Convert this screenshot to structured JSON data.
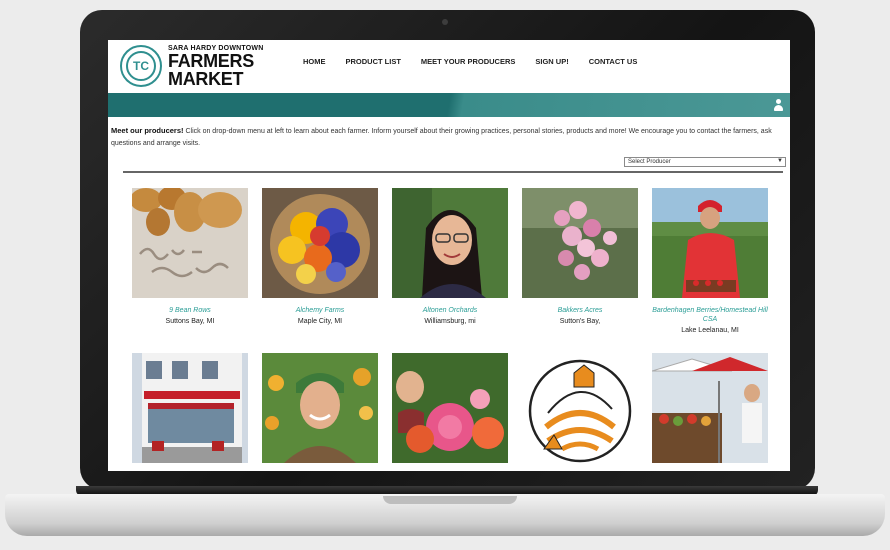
{
  "site": {
    "logo_initials": "TC",
    "logo_line1": "SARA HARDY DOWNTOWN",
    "logo_line2": "FARMERS",
    "logo_line3": "MARKET"
  },
  "nav": {
    "items": [
      {
        "label": "HOME"
      },
      {
        "label": "PRODUCT LIST"
      },
      {
        "label": "MEET YOUR PRODUCERS"
      },
      {
        "label": "SIGN UP!"
      },
      {
        "label": "CONTACT US"
      }
    ]
  },
  "intro": {
    "heading": "Meet our producers!",
    "body": "Click on drop-down menu at left to learn about each farmer. Inform yourself about their growing practices, personal stories, products and more! We encourage you to contact the farmers, ask questions and arrange visits."
  },
  "producer_select": {
    "selected": "Select Producer"
  },
  "producers": [
    {
      "name": "9 Bean Rows",
      "location": "Suttons Bay, MI"
    },
    {
      "name": "Alchemy Farms",
      "location": "Maple City, MI"
    },
    {
      "name": "Altonen Orchards",
      "location": "Williamsburg, mi"
    },
    {
      "name": "Bakkers Acres",
      "location": "Sutton's Bay,"
    },
    {
      "name": "Bardenhagen Berries/Homestead Hill CSA",
      "location": "Lake Leelanau, MI"
    },
    {
      "name": "",
      "location": ""
    },
    {
      "name": "",
      "location": ""
    },
    {
      "name": "",
      "location": ""
    },
    {
      "name": "",
      "location": ""
    },
    {
      "name": "",
      "location": ""
    }
  ],
  "colors": {
    "teal": "#1f6f6f",
    "link": "#2a9d96"
  }
}
